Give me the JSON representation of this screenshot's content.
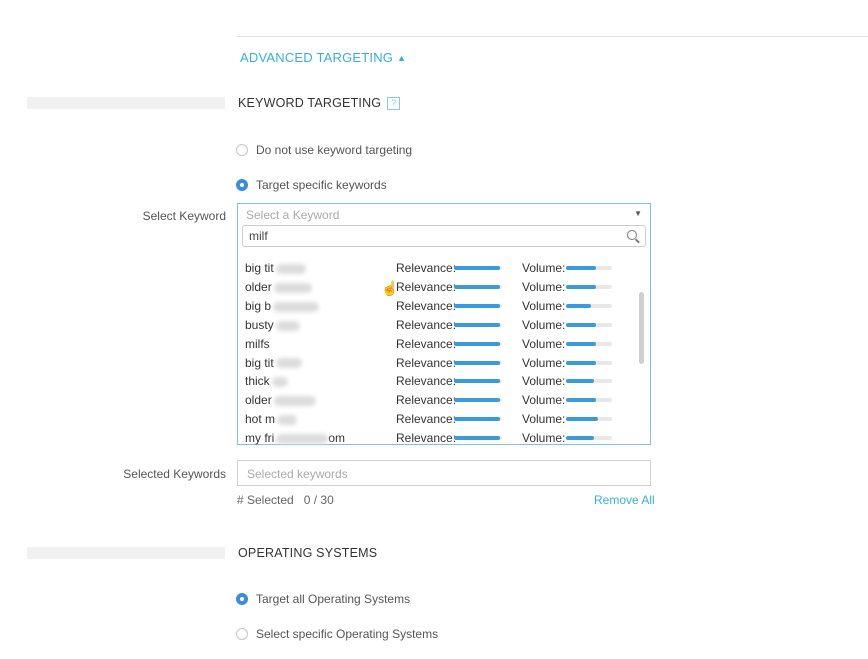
{
  "advanced_targeting": {
    "label": "ADVANCED TARGETING",
    "caret": "▲"
  },
  "keyword_targeting": {
    "title": "KEYWORD TARGETING",
    "help": "?",
    "options": [
      {
        "label": "Do not use keyword targeting",
        "checked": false
      },
      {
        "label": "Target specific keywords",
        "checked": true
      }
    ],
    "select_label": "Select Keyword",
    "select_placeholder": "Select a Keyword",
    "search_value": "milf",
    "relevance_label": "Relevance:",
    "volume_label": "Volume:",
    "keywords": [
      {
        "name": "big tit",
        "suffix": "",
        "relevance": 0.95,
        "volume": 0.65
      },
      {
        "name": "older",
        "suffix": "",
        "relevance": 0.95,
        "volume": 0.65
      },
      {
        "name": "big b",
        "suffix": "",
        "relevance": 0.95,
        "volume": 0.55
      },
      {
        "name": "busty",
        "suffix": "",
        "relevance": 0.95,
        "volume": 0.65
      },
      {
        "name": "milfs",
        "suffix": "",
        "relevance": 0.95,
        "volume": 0.65
      },
      {
        "name": "big tit",
        "suffix": "",
        "relevance": 0.95,
        "volume": 0.65
      },
      {
        "name": "thick",
        "suffix": "",
        "relevance": 0.95,
        "volume": 0.6
      },
      {
        "name": "older",
        "suffix": "",
        "relevance": 0.95,
        "volume": 0.65
      },
      {
        "name": "hot m",
        "suffix": "",
        "relevance": 0.95,
        "volume": 0.7
      },
      {
        "name": "my fri",
        "suffix": "om",
        "relevance": 0.95,
        "volume": 0.6
      }
    ],
    "selected_label": "Selected Keywords",
    "selected_placeholder": "Selected keywords",
    "count_label": "# Selected",
    "count_value": "0 / 30",
    "remove_all": "Remove All"
  },
  "operating_systems": {
    "title": "OPERATING SYSTEMS",
    "options": [
      {
        "label": "Target all Operating Systems",
        "checked": true
      },
      {
        "label": "Select specific Operating Systems",
        "checked": false
      }
    ]
  },
  "colors": {
    "accent": "#3aaed8",
    "bar": "#3a9bd8",
    "radio_on": "#3a8ed8"
  }
}
